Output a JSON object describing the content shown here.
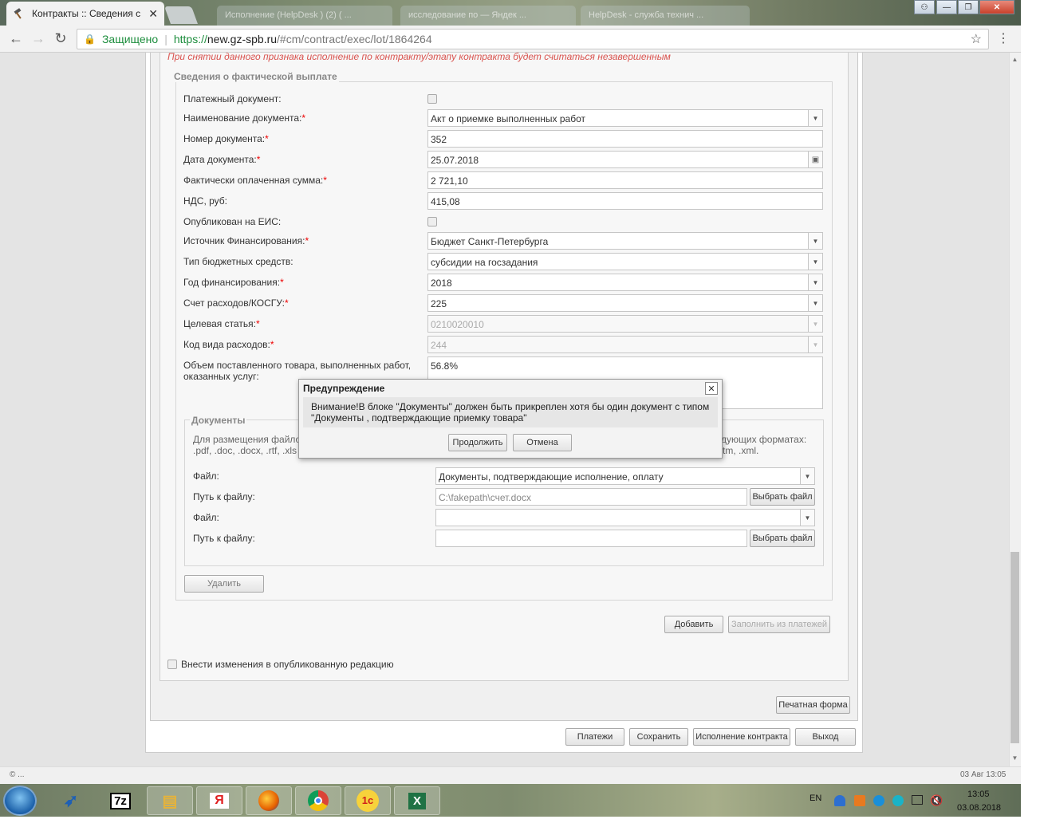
{
  "browser": {
    "active_tab_title": "Контракты :: Сведения с",
    "ghost_tabs": [
      "Исполнение (HelpDesk ) (2) ( ...",
      "исследование по — Яндек ...",
      "HelpDesk - служба технич ..."
    ],
    "security_label": "Защищено",
    "url_scheme": "https://",
    "url_host": "new.gz-spb.ru",
    "url_path": "/#cm/contract/exec/lot/1864264"
  },
  "form": {
    "warning_note": "При снятии данного признака исполнение по контракту/этапу контракта будет считаться незавершенным",
    "section_title": "Сведения о фактической выплате",
    "fields": {
      "payment_doc_label": "Платежный документ:",
      "doc_name_label": "Наименование документа:",
      "doc_name_value": "Акт о приемке выполненных работ",
      "doc_number_label": "Номер документа:",
      "doc_number_value": "352",
      "doc_date_label": "Дата документа:",
      "doc_date_value": "25.07.2018",
      "paid_sum_label": "Фактически оплаченная сумма:",
      "paid_sum_value": "2 721,10",
      "vat_label": "НДС, руб:",
      "vat_value": "415,08",
      "published_label": "Опубликован на ЕИС:",
      "fin_source_label": "Источник Финансирования:",
      "fin_source_value": "Бюджет Санкт-Петербурга",
      "budget_type_label": "Тип бюджетных средств:",
      "budget_type_value": "субсидии на госзадания",
      "fin_year_label": "Год финансирования:",
      "fin_year_value": "2018",
      "kosgu_label": "Счет расходов/КОСГУ:",
      "kosgu_value": "225",
      "target_item_label": "Целевая статья:",
      "target_item_value": "0210020010",
      "expense_code_label": "Код вида расходов:",
      "expense_code_value": "244",
      "volume_label_1": "Объем поставленного товара, выполненных работ,",
      "volume_label_2": "оказанных услуг:",
      "volume_value": "56.8%"
    },
    "documents": {
      "legend": "Документы",
      "info_left_1": "Для размещения файло",
      "info_left_2": ".pdf, .doc, .docx, .rtf, .xls",
      "info_right_1": "дующих форматах:",
      "info_right_2": "tm, .xml.",
      "file1_label": "Файл:",
      "file1_value": "Документы, подтверждающие исполнение, оплату",
      "path1_label": "Путь к файлу:",
      "path1_value": "C:\\fakepath\\счет.docx",
      "file2_label": "Файл:",
      "file2_value": "",
      "path2_label": "Путь к файлу:",
      "path2_value": "",
      "choose_file": "Выбрать файл"
    },
    "buttons": {
      "delete": "Удалить",
      "add": "Добавить",
      "fill_from_payments": "Заполнить из платежей",
      "print_form": "Печатная форма",
      "payments": "Платежи",
      "save": "Сохранить",
      "contract_execution": "Исполнение контракта",
      "exit": "Выход"
    },
    "edit_published_label": "Внести изменения в опубликованную редакцию"
  },
  "modal": {
    "title": "Предупреждение",
    "message_1": "Внимание!В блоке \"Документы\" должен быть прикреплен хотя бы один документ с типом",
    "message_2": "\"Документы , подтверждающие приемку товара\"",
    "continue": "Продолжить",
    "cancel": "Отмена"
  },
  "status": {
    "left": "© ...",
    "right": "03 Авг 13:05"
  },
  "taskbar": {
    "lang": "EN",
    "time": "13:05",
    "date": "03.08.2018"
  }
}
